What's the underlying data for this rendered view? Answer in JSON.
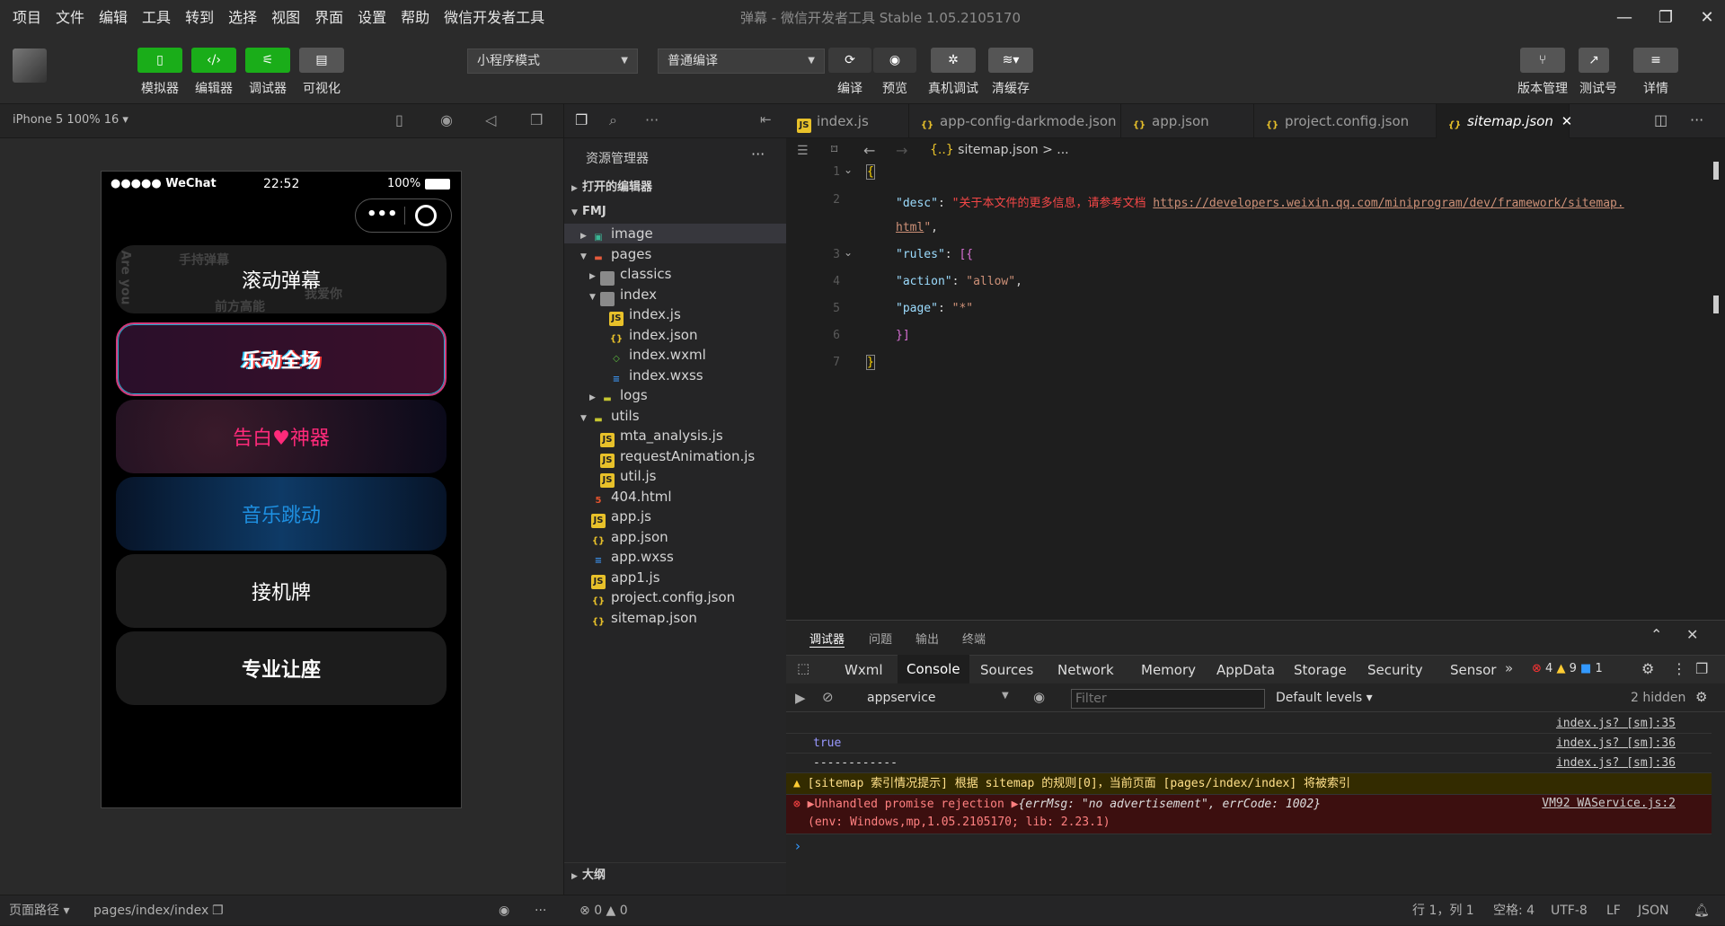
{
  "menu": [
    "项目",
    "文件",
    "编辑",
    "工具",
    "转到",
    "选择",
    "视图",
    "界面",
    "设置",
    "帮助",
    "微信开发者工具"
  ],
  "window_title": "弹幕 - 微信开发者工具 Stable 1.05.2105170",
  "toolbar": {
    "left_buttons": [
      "模拟器",
      "编辑器",
      "调试器",
      "可视化"
    ],
    "mode_select": "小程序模式",
    "compile_select": "普通编译",
    "actions": [
      "编译",
      "预览",
      "真机调试",
      "清缓存"
    ],
    "right_buttons": [
      "版本管理",
      "测试号",
      "详情"
    ]
  },
  "simulator": {
    "device": "iPhone 5 100% 16",
    "status_carrier": "●●●●● WeChat",
    "status_time": "22:52",
    "status_battery": "100%",
    "capsule_more": "•••",
    "cards": [
      "滚动弹幕",
      "乐动全场",
      "告白♥神器",
      "音乐跳动",
      "接机牌",
      "专业让座"
    ],
    "danmaku_bg": [
      "手持弹幕",
      "我爱你",
      "前方高能",
      "Are you"
    ]
  },
  "explorer": {
    "title": "资源管理器",
    "open_editors": "打开的编辑器",
    "project": "FMJ",
    "tree": [
      {
        "name": "image",
        "depth": 1,
        "type": "folder-img",
        "open": false
      },
      {
        "name": "pages",
        "depth": 1,
        "type": "folder-red",
        "open": true
      },
      {
        "name": "classics",
        "depth": 2,
        "type": "folder",
        "open": false
      },
      {
        "name": "index",
        "depth": 2,
        "type": "folder",
        "open": true
      },
      {
        "name": "index.js",
        "depth": 3,
        "type": "js"
      },
      {
        "name": "index.json",
        "depth": 3,
        "type": "json"
      },
      {
        "name": "index.wxml",
        "depth": 3,
        "type": "wxml"
      },
      {
        "name": "index.wxss",
        "depth": 3,
        "type": "wxss"
      },
      {
        "name": "logs",
        "depth": 2,
        "type": "folder-y",
        "open": false
      },
      {
        "name": "utils",
        "depth": 1,
        "type": "folder-y",
        "open": true
      },
      {
        "name": "mta_analysis.js",
        "depth": 2,
        "type": "js"
      },
      {
        "name": "requestAnimation.js",
        "depth": 2,
        "type": "js"
      },
      {
        "name": "util.js",
        "depth": 2,
        "type": "js"
      },
      {
        "name": "404.html",
        "depth": 1,
        "type": "html"
      },
      {
        "name": "app.js",
        "depth": 1,
        "type": "js"
      },
      {
        "name": "app.json",
        "depth": 1,
        "type": "json"
      },
      {
        "name": "app.wxss",
        "depth": 1,
        "type": "wxss"
      },
      {
        "name": "app1.js",
        "depth": 1,
        "type": "js"
      },
      {
        "name": "project.config.json",
        "depth": 1,
        "type": "json"
      },
      {
        "name": "sitemap.json",
        "depth": 1,
        "type": "json"
      }
    ],
    "outline": "大纲"
  },
  "tabs": [
    "index.js",
    "app-config-darkmode.json",
    "app.json",
    "project.config.json",
    "sitemap.json"
  ],
  "breadcrumb": "sitemap.json > ...",
  "code": {
    "desc_key": "\"desc\"",
    "desc_text": "\"关于本文件的更多信息，请参考文档",
    "desc_url": "https://developers.weixin.qq.com/miniprogram/dev/framework/sitemap.",
    "desc_url2": "html",
    "rules_key": "\"rules\"",
    "action_key": "\"action\"",
    "action_val": "\"allow\"",
    "page_key": "\"page\"",
    "page_val": "\"*\""
  },
  "devtools": {
    "top_tabs": [
      "调试器",
      "问题",
      "输出",
      "终端"
    ],
    "panels": [
      "Wxml",
      "Console",
      "Sources",
      "Network",
      "Memory",
      "AppData",
      "Storage",
      "Security",
      "Sensor"
    ],
    "errors": "4",
    "warnings": "9",
    "infos": "1",
    "context": "appservice",
    "filter_placeholder": "Filter",
    "levels": "Default levels",
    "hidden": "2 hidden",
    "lines": [
      {
        "text": "",
        "src": "index.js? [sm]:35"
      },
      {
        "text": "true",
        "src": "index.js? [sm]:36"
      },
      {
        "text": "------------",
        "src": "index.js? [sm]:36"
      }
    ],
    "warning_text": "[sitemap 索引情况提示] 根据 sitemap 的规则[0]，当前页面 [pages/index/index] 将被索引",
    "error_text": "Unhandled promise rejection",
    "error_obj": "{errMsg: \"no advertisement\", errCode: 1002}",
    "error_env": "(env: Windows,mp,1.05.2105170; lib: 2.23.1)",
    "error_src": "VM92 WAService.js:2"
  },
  "status": {
    "path_label": "页面路径",
    "path": "pages/index/index",
    "errors": "0",
    "warnings": "0",
    "cursor": "行 1，列 1",
    "spaces": "空格: 4",
    "encoding": "UTF-8",
    "eol": "LF",
    "lang": "JSON"
  }
}
